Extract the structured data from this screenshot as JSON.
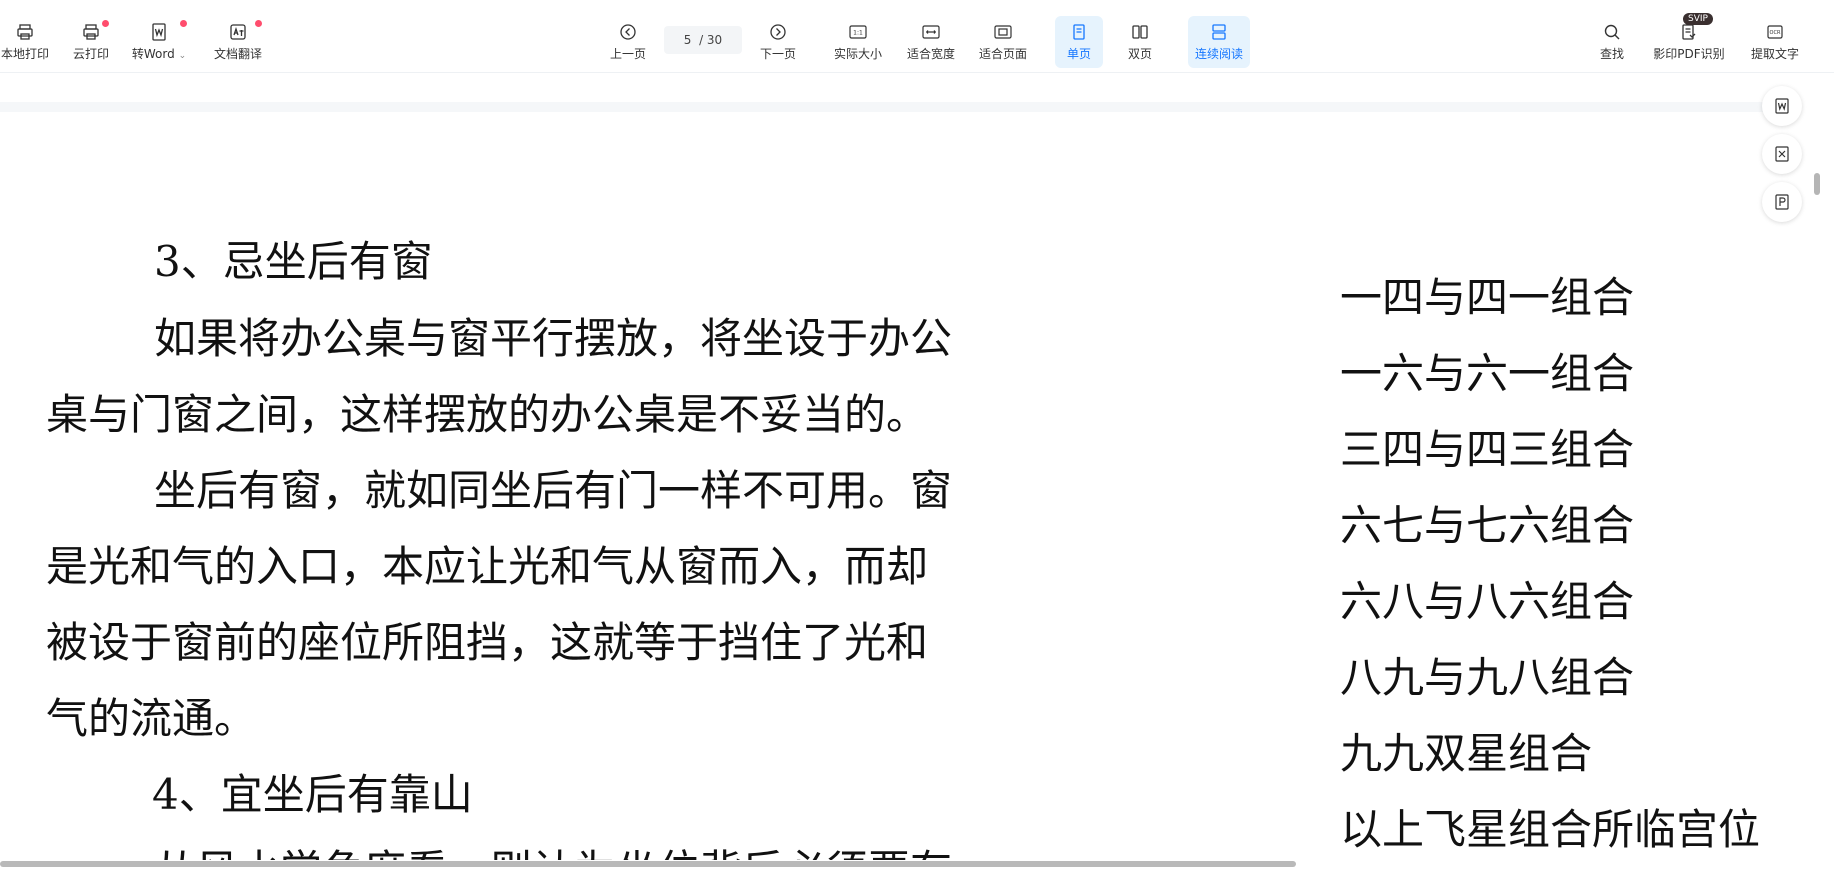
{
  "toolbar": {
    "local_print": "本地打印",
    "cloud_print": "云打印",
    "to_word": "转Word",
    "translate": "文档翻译",
    "prev_page": "上一页",
    "page_current": "5",
    "page_total": "/ 30",
    "next_page": "下一页",
    "actual_size": "实际大小",
    "fit_width": "适合宽度",
    "fit_page": "适合页面",
    "single_page": "单页",
    "double_page": "双页",
    "continuous": "连续阅读",
    "find": "查找",
    "ocr_pdf": "影印PDF识别",
    "extract_text": "提取文字",
    "svip_badge": "SVIP"
  },
  "colors": {
    "accent": "#1677ff",
    "active_bg": "#e6f3fd",
    "notify_dot": "#ff4d6d"
  },
  "document": {
    "left_page": {
      "h3": "3、忌坐后有窗",
      "p1_l1": "如果将办公桌与窗平行摆放，将坐设于办公",
      "p1_l2": "桌与门窗之间，这样摆放的办公桌是不妥当的。",
      "p2_l1": "坐后有窗，就如同坐后有门一样不可用。窗",
      "p2_l2": "是光和气的入口，本应让光和气从窗而入，而却",
      "p2_l3": "被设于窗前的座位所阻挡，这就等于挡住了光和",
      "p2_l4": "气的流通。",
      "h4": "4、宜坐后有靠山",
      "p3_partial": "从风水学角度看，则认为坐位背后必须要有"
    },
    "right_page": {
      "lines": [
        "一四与四一组合",
        "一六与六一组合",
        "三四与四三组合",
        "六七与七六组合",
        "六八与八六组合",
        "八九与九八组合",
        "九九双星组合",
        "以上飞星组合所临宫位"
      ]
    }
  }
}
